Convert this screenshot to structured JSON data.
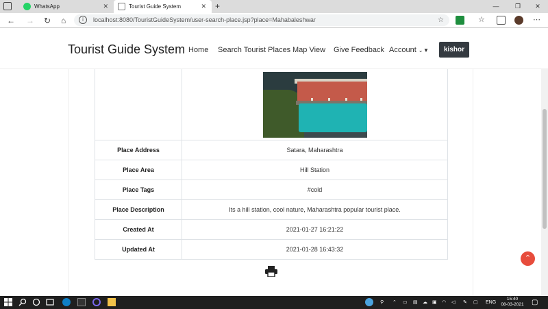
{
  "browser": {
    "tabs": [
      {
        "label": "WhatsApp"
      },
      {
        "label": "Tourist Guide System"
      }
    ],
    "new_tab": "+",
    "url": "localhost:8080/TouristGuideSystem/user-search-place.jsp?place=Mahabaleshwar"
  },
  "navbar": {
    "brand": "Tourist Guide System",
    "links": [
      {
        "label": "Home"
      },
      {
        "label": "Search Tourist Places"
      },
      {
        "label": "Map View"
      },
      {
        "label": "Give Feedback"
      },
      {
        "label": "Account"
      }
    ],
    "user": "kishor"
  },
  "details": {
    "rows": [
      {
        "key": "Place Address",
        "value": "Satara, Maharashtra"
      },
      {
        "key": "Place Area",
        "value": "Hill Station"
      },
      {
        "key": "Place Tags",
        "value": "#cold"
      },
      {
        "key": "Place Description",
        "value": "Its a hill station, cool nature, Maharashtra popular tourist place."
      },
      {
        "key": "Created At",
        "value": "2021-01-27 16:21:22"
      },
      {
        "key": "Updated At",
        "value": "2021-01-28 16:43:32"
      }
    ]
  },
  "taskbar": {
    "lang": "ENG",
    "time": "15:40",
    "date": "08-03-2021"
  },
  "colors": {
    "accent_dark": "#343a40",
    "scroll_top": "#e74c3c",
    "whatsapp": "#25d366"
  }
}
